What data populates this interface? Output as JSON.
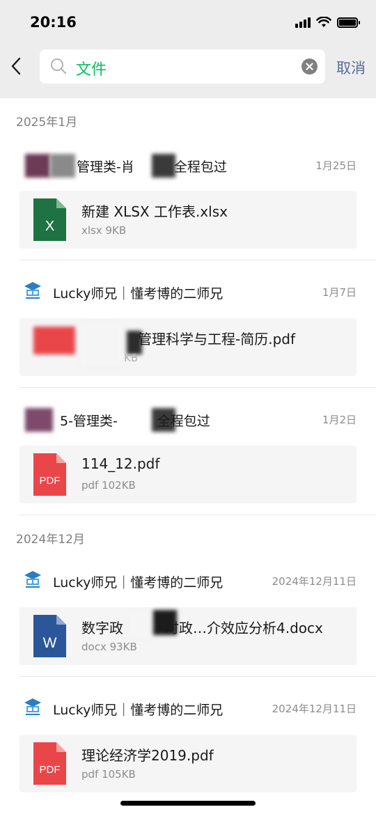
{
  "status": {
    "time": "20:16"
  },
  "search": {
    "query": "文件",
    "cancel_label": "取消"
  },
  "sections": [
    {
      "header": "2025年1月",
      "items": [
        {
          "sender": "管理类-肖　　　全程包过",
          "date": "1月25日",
          "file_name": "新建 XLSX 工作表.xlsx",
          "file_meta": "xlsx 9KB",
          "file_type": "xlsx"
        },
        {
          "sender": "Lucky师兄｜懂考博的二师兄",
          "date": "1月7日",
          "file_name": "管理科学与工程-简历.pdf",
          "file_meta": "KB",
          "file_type": "pdf"
        },
        {
          "sender": "5-管理类-　　　全程包过",
          "date": "1月2日",
          "file_name": "114_12.pdf",
          "file_meta": "pdf 102KB",
          "file_type": "pdf"
        }
      ]
    },
    {
      "header": "2024年12月",
      "items": [
        {
          "sender": "Lucky师兄｜懂考博的二师兄",
          "date": "2024年12月11日",
          "file_name": "数字政　　　时政…介效应分析4.docx",
          "file_meta": "docx 93KB",
          "file_type": "docx"
        },
        {
          "sender": "Lucky师兄｜懂考博的二师兄",
          "date": "2024年12月11日",
          "file_name": "理论经济学2019.pdf",
          "file_meta": "pdf 105KB",
          "file_type": "pdf"
        }
      ]
    }
  ],
  "icons": {
    "xlsx": {
      "glyph": "X",
      "color": "#1f7244"
    },
    "pdf": {
      "glyph": "PDF",
      "color": "#e9464a"
    },
    "docx": {
      "glyph": "W",
      "color": "#2b579a"
    }
  },
  "colors": {
    "accent_green": "#07c160",
    "link_blue": "#576b95"
  }
}
